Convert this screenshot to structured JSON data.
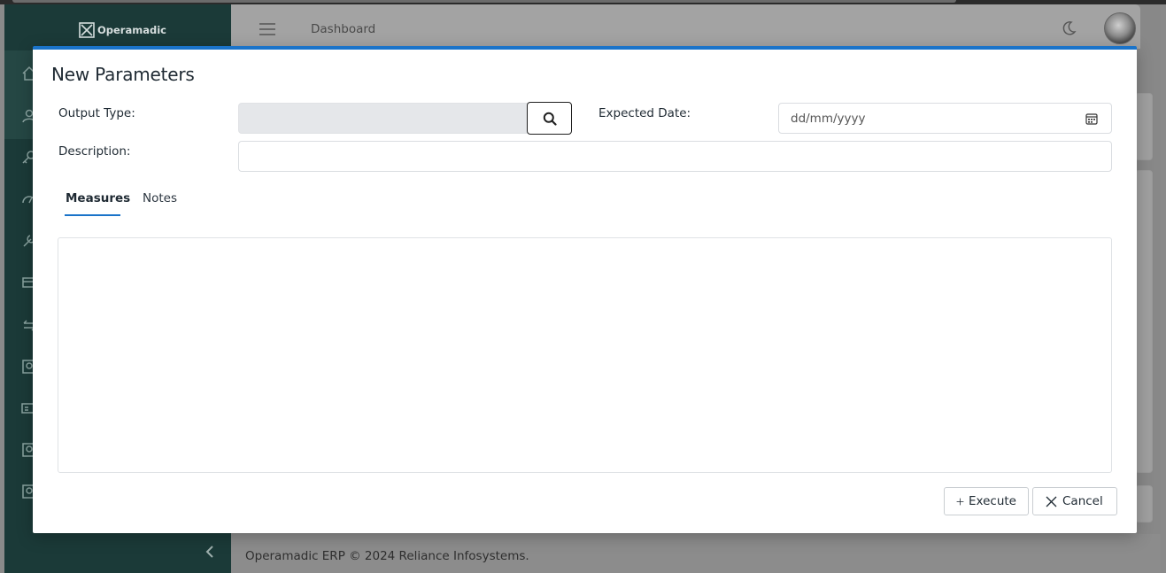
{
  "app": {
    "brand": "Operamadic",
    "breadcrumb": "Dashboard",
    "footer": "Operamadic ERP © 2024 Reliance Infosystems."
  },
  "modal": {
    "title": "New Parameters",
    "fields": {
      "output_type_label": "Output Type:",
      "output_type_value": "",
      "expected_date_label": "Expected Date:",
      "expected_date_placeholder": "dd/mm/yyyy",
      "description_label": "Description:",
      "description_value": ""
    },
    "tabs": [
      {
        "label": "Measures",
        "active": true
      },
      {
        "label": "Notes",
        "active": false
      }
    ],
    "buttons": {
      "execute": "Execute",
      "cancel": "Cancel"
    }
  },
  "icons": {
    "search": "search-icon",
    "calendar": "calendar-icon",
    "plus": "plus-icon",
    "close": "close-icon",
    "hamburger": "hamburger-icon",
    "moon": "moon-icon"
  },
  "colors": {
    "accent": "#1a73c9",
    "sidebar": "#1b3a38",
    "overlay": "#888888"
  }
}
